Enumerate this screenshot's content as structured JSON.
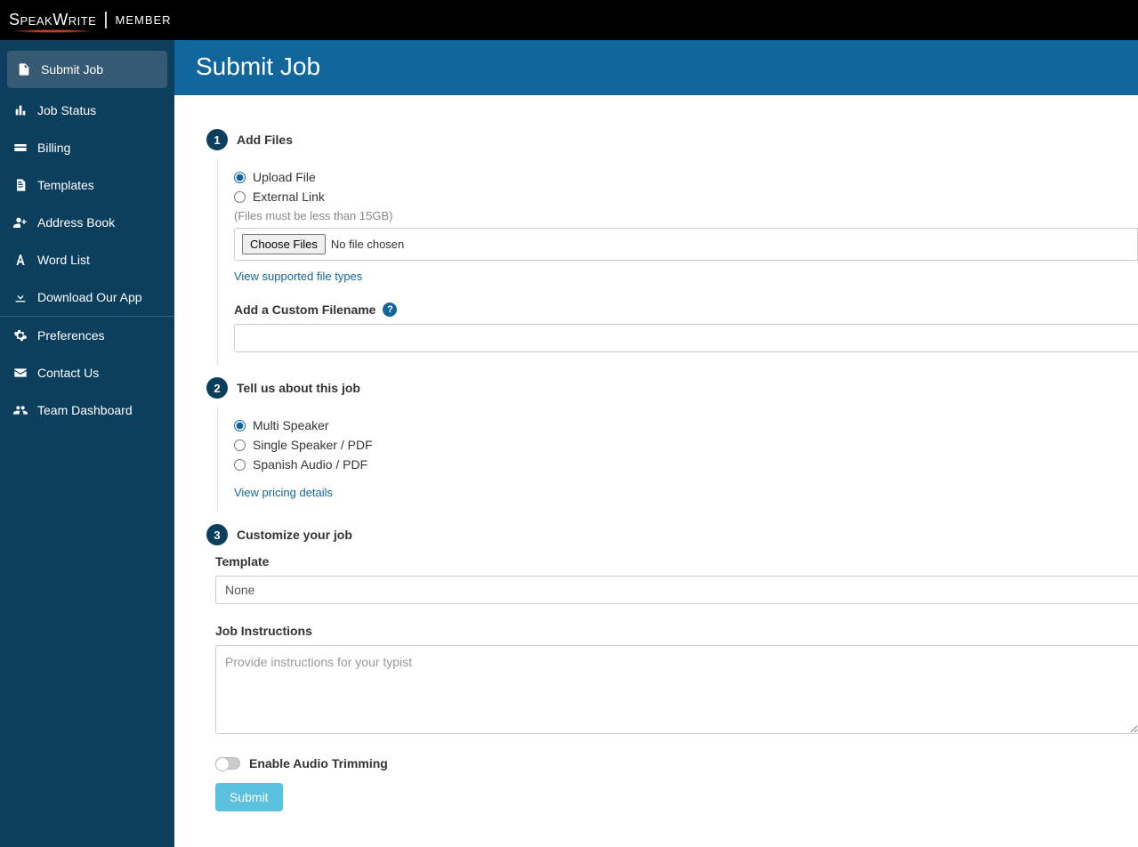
{
  "brand": {
    "logo_primary": "Speak",
    "logo_secondary": "Write",
    "member": "MEMBER"
  },
  "page": {
    "title": "Submit Job"
  },
  "sidebar": {
    "items": [
      {
        "label": "Submit Job"
      },
      {
        "label": "Job Status"
      },
      {
        "label": "Billing"
      },
      {
        "label": "Templates"
      },
      {
        "label": "Address Book"
      },
      {
        "label": "Word List"
      },
      {
        "label": "Download Our App"
      }
    ],
    "lower": [
      {
        "label": "Preferences"
      },
      {
        "label": "Contact Us"
      },
      {
        "label": "Team Dashboard"
      }
    ]
  },
  "steps": {
    "s1": {
      "num": "1",
      "title": "Add Files",
      "upload_opt": "Upload File",
      "external_opt": "External Link",
      "limit_hint": "(Files must be less than 15GB)",
      "choose_btn": "Choose Files",
      "no_file": "No file chosen",
      "supported_link": "View supported file types",
      "custom_fn_label": "Add a Custom Filename"
    },
    "s2": {
      "num": "2",
      "title": "Tell us about this job",
      "multi": "Multi Speaker",
      "single": "Single Speaker / PDF",
      "spanish": "Spanish Audio / PDF",
      "pricing_link": "View pricing details"
    },
    "s3": {
      "num": "3",
      "title": "Customize your job",
      "template_label": "Template",
      "template_value": "None",
      "instr_label": "Job Instructions",
      "instr_placeholder": "Provide instructions for your typist",
      "trim_label": "Enable Audio Trimming",
      "submit": "Submit"
    }
  }
}
